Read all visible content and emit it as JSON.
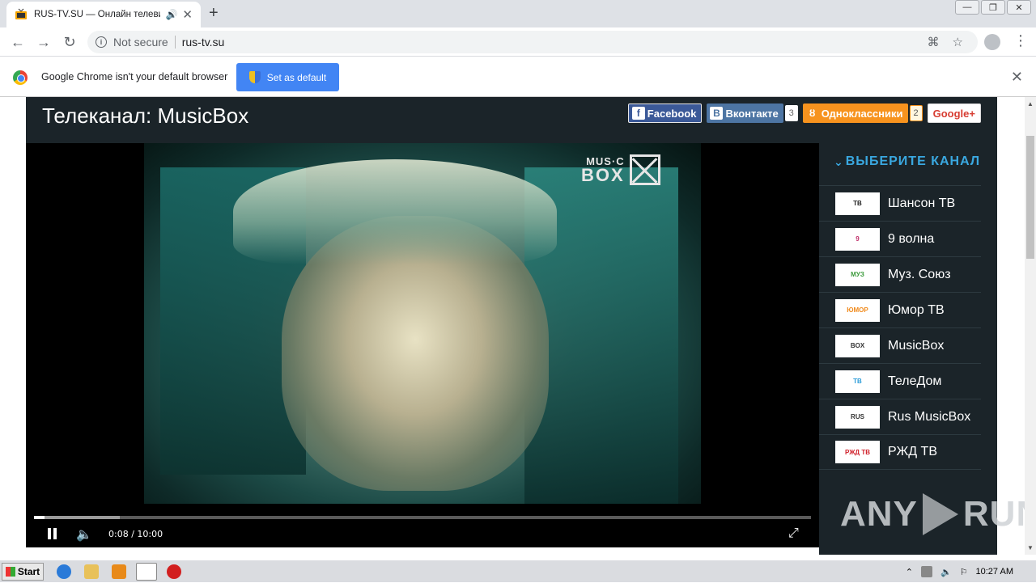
{
  "browser": {
    "tab_title": "RUS-TV.SU — Онлайн телевид",
    "not_secure": "Not secure",
    "url": "rus-tv.su",
    "window_controls": [
      "minimize",
      "restore",
      "close"
    ]
  },
  "infobar": {
    "message": "Google Chrome isn't your default browser",
    "button": "Set as default"
  },
  "page": {
    "title": "Телеканал: MusicBox",
    "social": [
      {
        "label": "Facebook",
        "count": ""
      },
      {
        "label": "Вконтакте",
        "count": "3"
      },
      {
        "label": "Одноклассники",
        "count": "2"
      },
      {
        "label": "Google+",
        "count": ""
      }
    ],
    "player": {
      "logo_top": "MUS·C",
      "logo_bottom": "BOX",
      "time": "0:08 / 10:00",
      "progress": 0.0133,
      "buffered": 0.11
    },
    "sidebar": {
      "heading": "ВЫБЕРИТЕ КАНАЛ",
      "channels": [
        {
          "name": "Шансон ТВ",
          "logo": "ТВ",
          "color": "#222222"
        },
        {
          "name": "9 волна",
          "logo": "9",
          "color": "#c0306a"
        },
        {
          "name": "Муз. Союз",
          "logo": "МУЗ",
          "color": "#3a9a3a"
        },
        {
          "name": "Юмор ТВ",
          "logo": "ЮМОР",
          "color": "#f08a1c"
        },
        {
          "name": "MusicBox",
          "logo": "BOX",
          "color": "#333333"
        },
        {
          "name": "ТелеДом",
          "logo": "ТВ",
          "color": "#2a9bd8"
        },
        {
          "name": "Rus MusicBox",
          "logo": "RUS",
          "color": "#333333"
        },
        {
          "name": "РЖД ТВ",
          "logo": "РЖД ТВ",
          "color": "#d0202a"
        }
      ]
    },
    "watermark": {
      "left": "ANY",
      "right": "RUN"
    }
  },
  "taskbar": {
    "start": "Start",
    "clock": "10:27 AM"
  }
}
